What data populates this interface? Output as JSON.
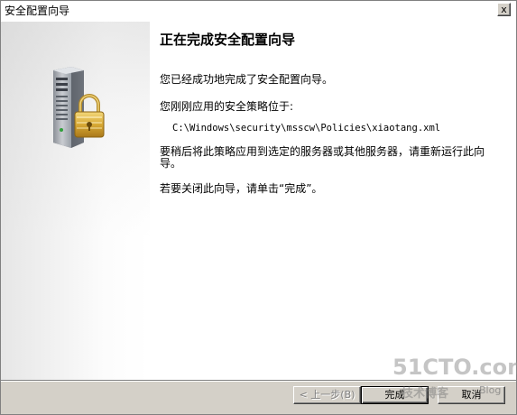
{
  "window": {
    "title": "安全配置向导",
    "close_glyph": "x"
  },
  "content": {
    "heading": "正在完成安全配置向导",
    "completed_text": "您已经成功地完成了安全配置向导。",
    "policy_label": "您刚刚应用的安全策略位于:",
    "policy_path": "C:\\Windows\\security\\msscw\\Policies\\xiaotang.xml",
    "later_text": "要稍后将此策略应用到选定的服务器或其他服务器，请重新运行此向导。",
    "close_text": "若要关闭此向导，请单击“完成”。"
  },
  "buttons": {
    "back": "< 上一步(B)",
    "finish": "完成",
    "cancel": "取消"
  },
  "watermark": {
    "site": "51CTO.com",
    "tagline": "技术博客",
    "blog": "Blog"
  },
  "icon": "server-lock-icon"
}
